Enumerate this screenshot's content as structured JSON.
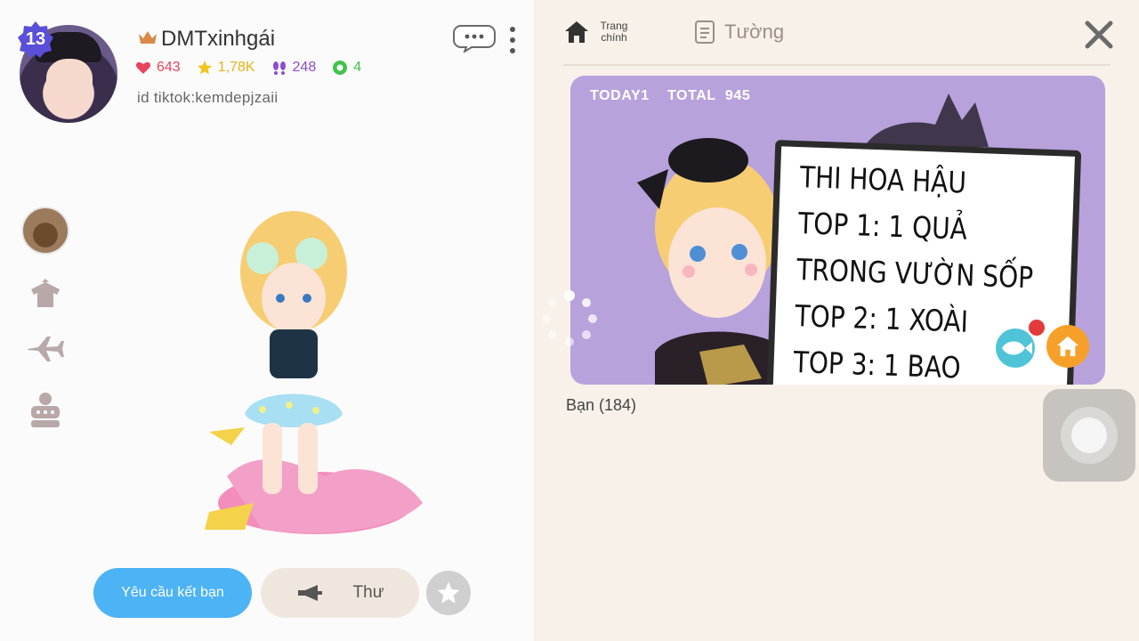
{
  "profile": {
    "level": "13",
    "username": "DMTxinhgái",
    "stats": {
      "hearts": "643",
      "stars": "1,78K",
      "footprints": "248",
      "points": "4"
    },
    "bio": "id tiktok:kemdepjzaii"
  },
  "actions": {
    "friend_request": "Yêu cầu kết bạn",
    "mail": "Thư"
  },
  "tabs": {
    "home": "Trang chính",
    "wall": "Tường"
  },
  "banner": {
    "today_label": "TODAY",
    "today": "1",
    "total_label": "TOTAL",
    "total": "945",
    "board_lines": [
      "THI HOA HẬU",
      "TOP 1:  1 QUẢ",
      "TRONG VƯỜN SỐP",
      "TOP 2: 1 XOÀI",
      "TOP 3: 1 BAO"
    ]
  },
  "friends": {
    "label": "Bạn (184)"
  },
  "icons": {
    "crown": "crown-icon",
    "heart": "heart-icon",
    "star": "star-icon",
    "footprint": "footprint-icon",
    "point": "clover-icon",
    "chat": "chat-bubble-icon",
    "more": "more-vertical-icon",
    "close": "close-icon",
    "home": "home-icon",
    "wall": "notepad-icon"
  },
  "colors": {
    "accent_blue": "#4cb3f4",
    "level_badge": "#5a4fd8",
    "heart": "#e8445e",
    "star": "#f2c31c",
    "footprint": "#8d4ccf",
    "point": "#43c24a",
    "home_fab": "#f6a02a"
  }
}
